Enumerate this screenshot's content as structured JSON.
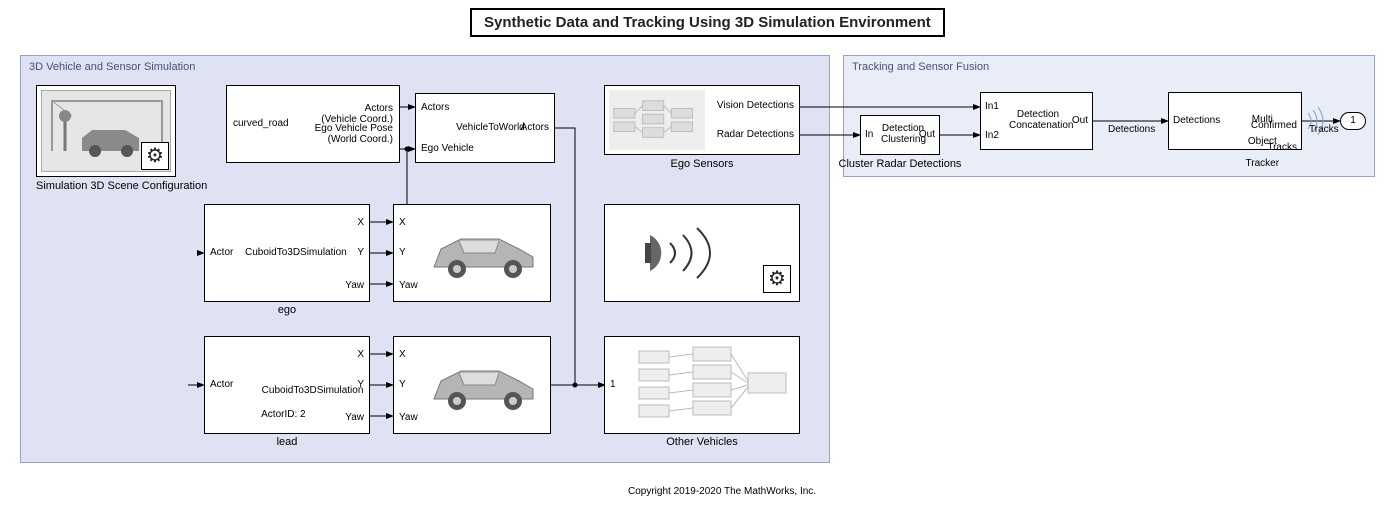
{
  "title": "Synthetic Data and Tracking Using 3D Simulation Environment",
  "copyright": "Copyright 2019-2020 The MathWorks, Inc.",
  "sim_subsystem": "3D Vehicle and Sensor Simulation",
  "fusion_subsystem": "Tracking and Sensor Fusion",
  "blocks": {
    "scene_config": "Simulation 3D Scene Configuration",
    "scenario_reader": {
      "center": "curved_road",
      "out1a": "Actors",
      "out1b": "(Vehicle Coord.)",
      "out2a": "Ego Vehicle Pose",
      "out2b": "(World Coord.)"
    },
    "veh2world": {
      "name": "VehicleToWorld",
      "in1": "Actors",
      "in2": "Ego Vehicle",
      "out": "Actors"
    },
    "ego_cuboid": {
      "label": "ego",
      "text": "CuboidTo3DSimulation",
      "in": "Actor",
      "outX": "X",
      "outY": "Y",
      "outYaw": "Yaw"
    },
    "lead_cuboid": {
      "label": "lead",
      "text_line1": "CuboidTo3DSimulation",
      "text_line2": "ActorID: 2",
      "in": "Actor",
      "outX": "X",
      "outY": "Y",
      "outYaw": "Yaw"
    },
    "vehicle_block": {
      "inX": "X",
      "inY": "Y",
      "inYaw": "Yaw"
    },
    "ego_sensors": {
      "label": "Ego Sensors",
      "out1": "Vision Detections",
      "out2": "Radar Detections"
    },
    "other_vehicles": {
      "label": "Other Vehicles",
      "in1": "1"
    },
    "cluster": {
      "label": "Cluster Radar Detections",
      "text": "Detection\nClustering",
      "in": "In",
      "out": "Out"
    },
    "concat": {
      "text": "Detection\nConcatenation",
      "in1": "In1",
      "in2": "In2",
      "out": "Out"
    },
    "tracker": {
      "line1": "Multi",
      "line2": "Object",
      "line3": "Tracker",
      "in": "Detections",
      "out1": "Confirmed",
      "out2": "Tracks"
    },
    "out_port": "1"
  },
  "signals": {
    "detections": "Detections",
    "tracks": "Tracks"
  }
}
